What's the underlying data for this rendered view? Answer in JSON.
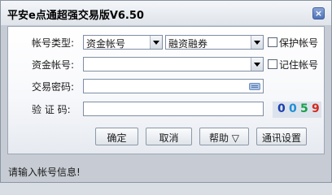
{
  "window": {
    "title": "平安e点通超强交易版V6.50"
  },
  "form": {
    "account_type": {
      "label": "帐号类型:",
      "type_value": "资金帐号",
      "mode_value": "融资融券",
      "protect_label": "保护帐号"
    },
    "fund_account": {
      "label": "资金帐号:",
      "value": "",
      "remember_label": "记住帐号"
    },
    "trade_password": {
      "label": "交易密码:",
      "value": ""
    },
    "captcha": {
      "label": "验 证 码:",
      "value": "",
      "digits": [
        "0",
        "0",
        "5",
        "9"
      ],
      "digit_colors": [
        "#1b3fae",
        "#1e8fd6",
        "#18a04a",
        "#d42a1f"
      ]
    }
  },
  "buttons": {
    "ok": "确定",
    "cancel": "取消",
    "help": "帮助 ▽",
    "comm": "通讯设置"
  },
  "status": {
    "text": "请输入帐号信息!"
  }
}
